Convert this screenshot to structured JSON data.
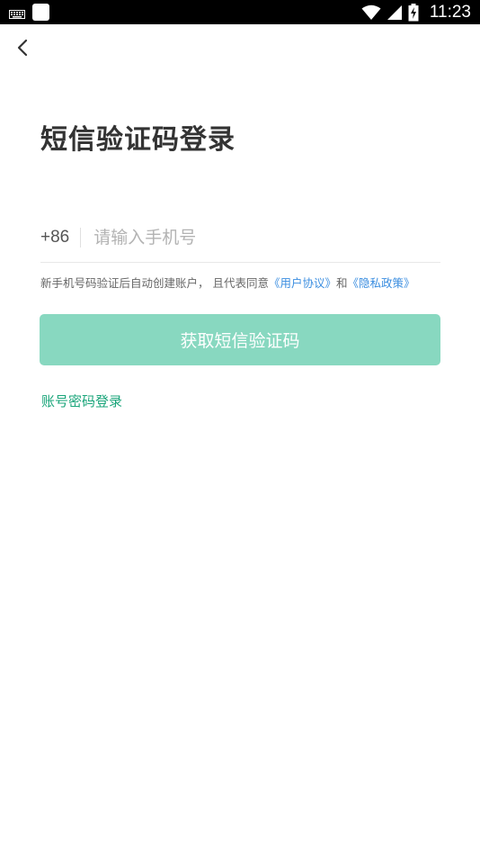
{
  "status_bar": {
    "time": "11:23",
    "icons": [
      "keyboard-icon",
      "notification-icon",
      "wifi-icon",
      "signal-icon",
      "battery-charging-icon"
    ]
  },
  "nav": {
    "back_icon": "chevron-left-icon"
  },
  "title": "短信验证码登录",
  "phone": {
    "country_code": "+86",
    "placeholder": "请输入手机号",
    "value": ""
  },
  "agreement": {
    "prefix": "新手机号码验证后自动创建账户，",
    "middle": " 且代表同意",
    "user_agreement": "《用户协议》",
    "conjunction": "和",
    "privacy_policy": "《隐私政策》"
  },
  "buttons": {
    "get_code": "获取短信验证码",
    "password_login": "账号密码登录"
  },
  "colors": {
    "primary_button": "#88d8c0",
    "link_green": "#1aa57a",
    "link_blue": "#3b8ee0",
    "title_text": "#333333"
  }
}
